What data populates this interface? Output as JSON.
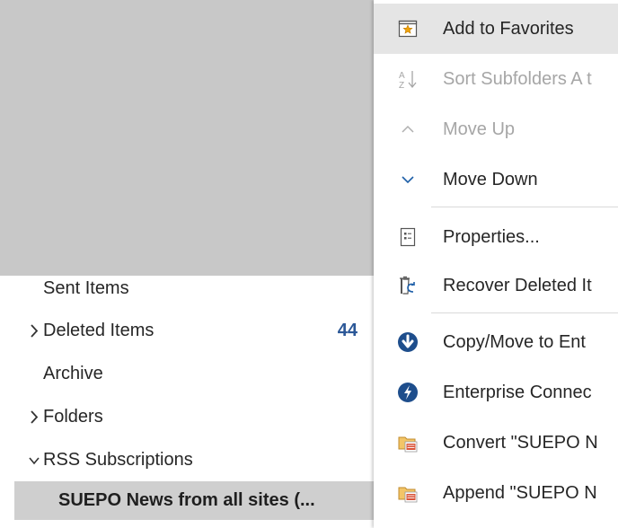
{
  "folders": [
    {
      "label": "Sent Items",
      "chevron": "",
      "count": ""
    },
    {
      "label": "Deleted Items",
      "chevron": "›",
      "count": "44"
    },
    {
      "label": "Archive",
      "chevron": "",
      "count": ""
    },
    {
      "label": "Folders",
      "chevron": "›",
      "count": ""
    },
    {
      "label": "RSS Subscriptions",
      "chevron": "⌄",
      "count": ""
    },
    {
      "label": "SUEPO News from all sites (...",
      "chevron": "",
      "count": ""
    }
  ],
  "menu": {
    "items": [
      {
        "label": "Add to Favorites",
        "icon": "star-folder-icon",
        "disabled": false
      },
      {
        "label": "Sort Subfolders A t",
        "icon": "sort-az-icon",
        "disabled": true
      },
      {
        "label": "Move Up",
        "icon": "chevron-up-icon",
        "disabled": true
      },
      {
        "label": "Move Down",
        "icon": "chevron-down-icon",
        "disabled": false
      },
      {
        "label": "Properties...",
        "icon": "properties-icon",
        "disabled": false
      },
      {
        "label": "Recover Deleted It",
        "icon": "recover-deleted-icon",
        "disabled": false
      },
      {
        "label": "Copy/Move to Ent",
        "icon": "copy-move-icon",
        "disabled": false
      },
      {
        "label": "Enterprise Connec",
        "icon": "enterprise-connect-icon",
        "disabled": false
      },
      {
        "label": "Convert \"SUEPO N",
        "icon": "convert-rss-icon",
        "disabled": false
      },
      {
        "label": "Append \"SUEPO N",
        "icon": "append-rss-icon",
        "disabled": false
      }
    ]
  },
  "colors": {
    "accent_blue": "#2b5797",
    "hover": "#e5e5e5",
    "disabled_text": "#a6a6a6",
    "selected_row": "#cfcfcf",
    "icon_blue": "#1e5fa8"
  }
}
